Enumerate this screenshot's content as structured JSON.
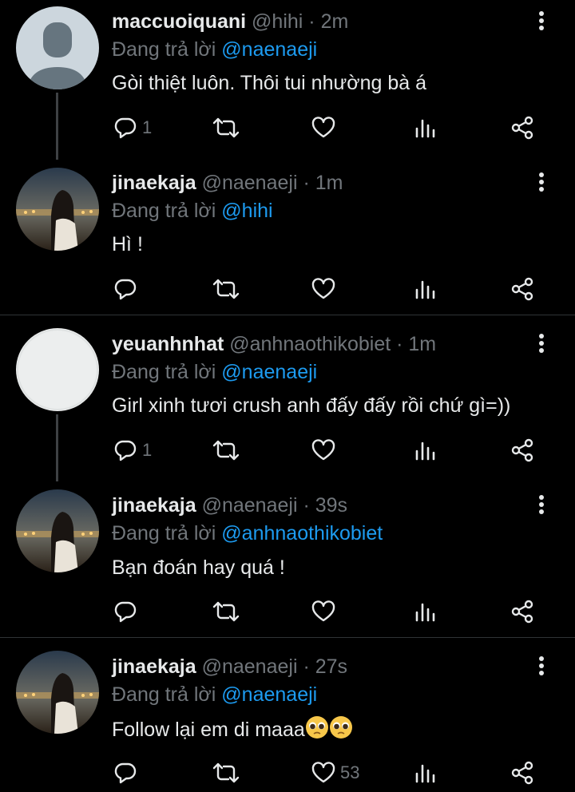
{
  "reply_prefix": "Đang trả lời",
  "dot": "·",
  "tweets": [
    {
      "name": "maccuoiquani",
      "handle": "@hihi",
      "time": "2m",
      "reply_to": "@naenaeji",
      "text": "Gòi thiệt luôn. Thôi tui nhường bà á",
      "reply_count": "1",
      "like_count": ""
    },
    {
      "name": "jinaekaja",
      "handle": "@naenaeji",
      "time": "1m",
      "reply_to": "@hihi",
      "text": "Hì !",
      "reply_count": "",
      "like_count": ""
    },
    {
      "name": "yeuanhnhat",
      "handle": "@anhnaothikobiet",
      "time": "1m",
      "reply_to": "@naenaeji",
      "text": "Girl xinh tươi crush anh đấy đấy rồi chứ gì=))",
      "reply_count": "1",
      "like_count": ""
    },
    {
      "name": "jinaekaja",
      "handle": "@naenaeji",
      "time": "39s",
      "reply_to": "@anhnaothikobiet",
      "text": "Bạn đoán hay quá !",
      "reply_count": "",
      "like_count": ""
    },
    {
      "name": "jinaekaja",
      "handle": "@naenaeji",
      "time": "27s",
      "reply_to": "@naenaeji",
      "text": "Follow lại em di maaa",
      "reply_count": "",
      "like_count": "53"
    }
  ],
  "colors": {
    "background": "#000000",
    "mention": "#1d9bf0",
    "muted": "#71767b",
    "divider": "#2f3336"
  },
  "icons": [
    "reply-icon",
    "retweet-icon",
    "like-icon",
    "analytics-icon",
    "share-icon",
    "more-icon",
    "pleading-face-emoji"
  ]
}
